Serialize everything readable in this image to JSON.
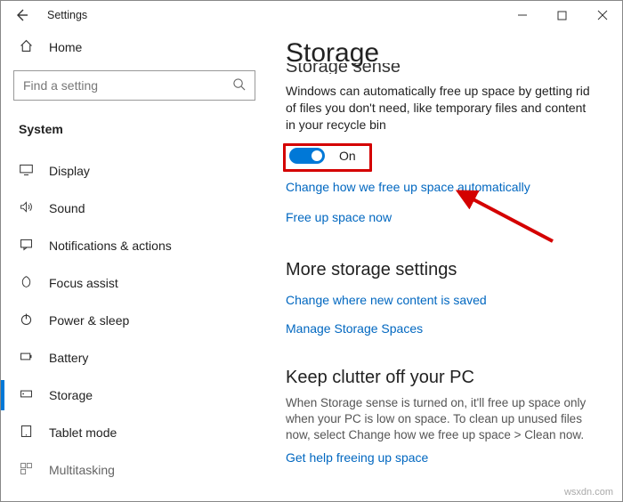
{
  "window": {
    "title": "Settings"
  },
  "sidebar": {
    "home": "Home",
    "search_placeholder": "Find a setting",
    "group": "System",
    "items": [
      {
        "label": "Display"
      },
      {
        "label": "Sound"
      },
      {
        "label": "Notifications & actions"
      },
      {
        "label": "Focus assist"
      },
      {
        "label": "Power & sleep"
      },
      {
        "label": "Battery"
      },
      {
        "label": "Storage"
      },
      {
        "label": "Tablet mode"
      },
      {
        "label": "Multitasking"
      }
    ]
  },
  "content": {
    "page_title": "Storage",
    "sense_heading": "Storage sense",
    "sense_desc": "Windows can automatically free up space by getting rid of files you don't need, like temporary files and content in your recycle bin",
    "toggle": {
      "state": "On"
    },
    "link_change_auto": "Change how we free up space automatically",
    "link_free_now": "Free up space now",
    "more_heading": "More storage settings",
    "link_change_save": "Change where new content is saved",
    "link_manage_spaces": "Manage Storage Spaces",
    "clutter_heading": "Keep clutter off your PC",
    "clutter_desc": "When Storage sense is turned on, it'll free up space only when your PC is low on space. To clean up unused files now, select Change how we free up space > Clean now.",
    "link_help": "Get help freeing up space"
  },
  "watermark": "wsxdn.com"
}
